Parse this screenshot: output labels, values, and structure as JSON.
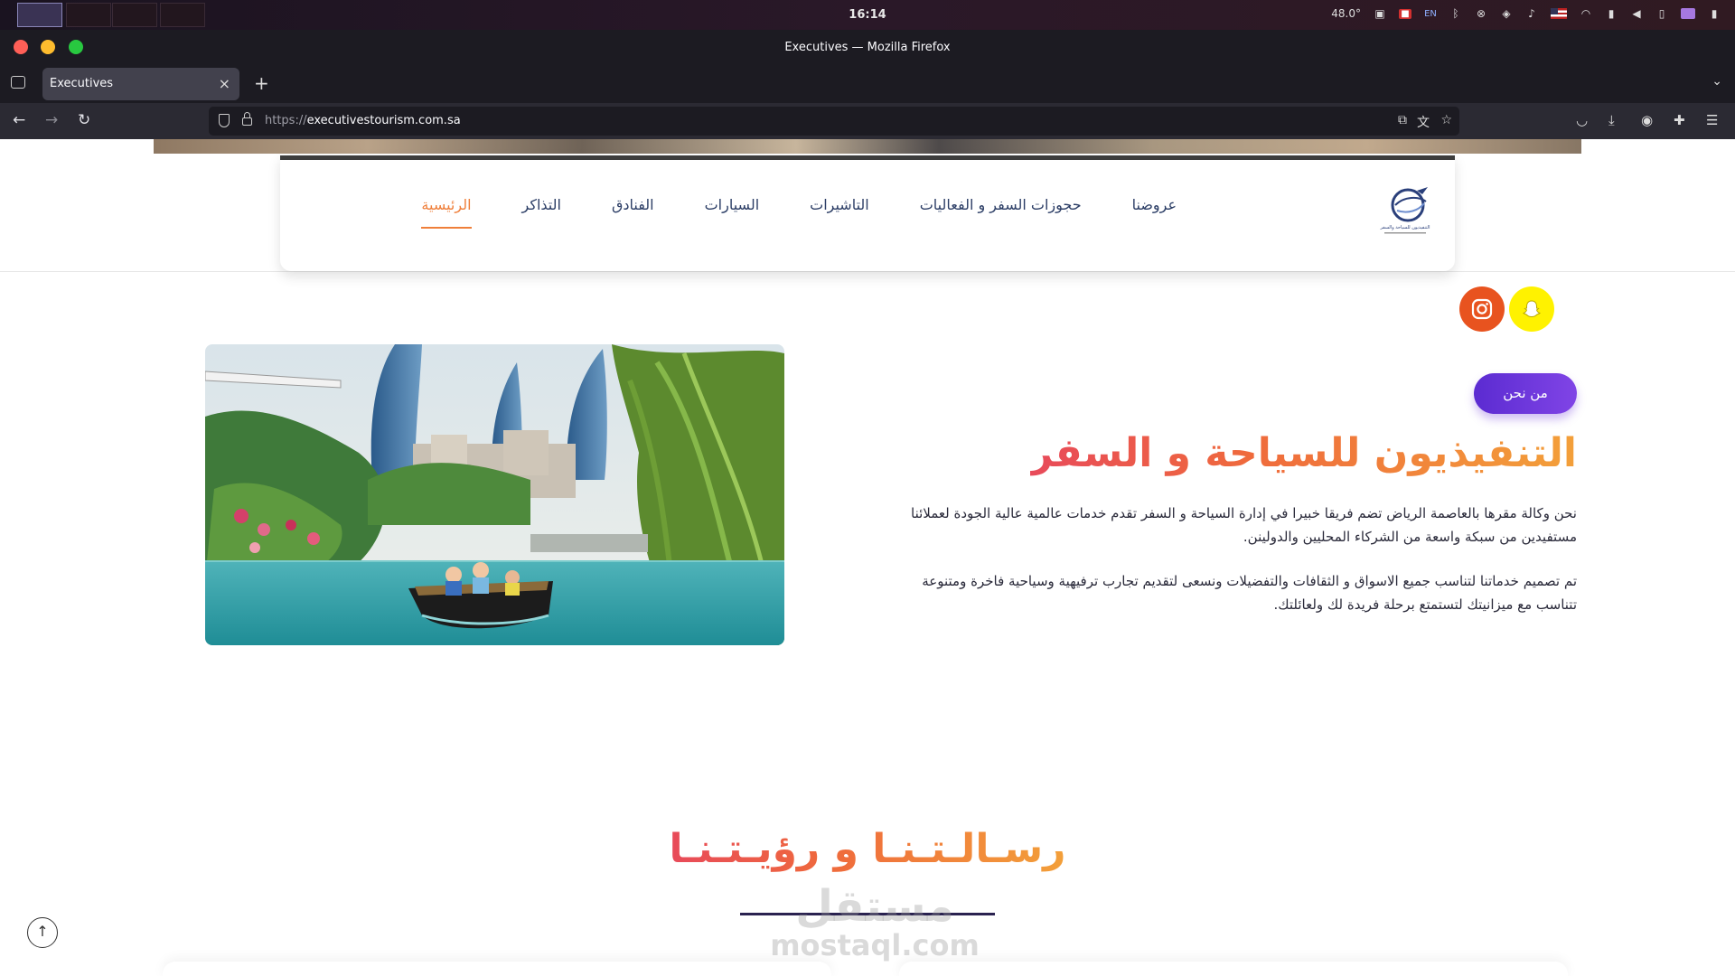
{
  "os": {
    "clock": "16:14",
    "temp": "48.0°",
    "lang": "EN"
  },
  "browser": {
    "window_title": "Executives — Mozilla Firefox",
    "tab_title": "Executives",
    "url_proto": "https://",
    "url_host": "executivestourism.com.sa",
    "icons": [
      "back-icon",
      "forward-icon",
      "reload-icon",
      "shield-icon",
      "lock-icon",
      "bookmark-star-icon",
      "pocket-icon",
      "download-icon",
      "account-icon",
      "extensions-icon",
      "menu-icon"
    ]
  },
  "site": {
    "logo_text": "التنفيذيون للسياحة والسفر",
    "menu": [
      {
        "label": "الرئيسية",
        "active": true
      },
      {
        "label": "التذاكر",
        "active": false
      },
      {
        "label": "الفنادق",
        "active": false
      },
      {
        "label": "السيارات",
        "active": false
      },
      {
        "label": "التاشيرات",
        "active": false
      },
      {
        "label": "حجوزات السفر و الفعاليات",
        "active": false
      },
      {
        "label": "عروضنا",
        "active": false
      }
    ],
    "social": [
      {
        "name": "instagram-icon",
        "color": "#e8531f"
      },
      {
        "name": "snapchat-icon",
        "color": "#fff200"
      }
    ],
    "about": {
      "badge": "من نحن",
      "title": "التنفيذيون للسياحة و السفر",
      "paragraph1": "نحن وكالة مقرها بالعاصمة الرياض تضم فريقا خبيرا في إدارة السياحة و السفر تقدم خدمات عالمية عالية الجودة لعملائنا مستفيدين من سبكة واسعة من الشركاء المحليين والدولينن.",
      "paragraph2": "تم تصميم خدماتنا لتناسب جميع الاسواق و الثقافات والتفضيلات ونسعى لتقديم تجارب ترفيهية وسياحية فاخرة ومتنوعة تتناسب مع ميزانيتك لتستمتع برحلة فريدة لك ولعائلتك."
    },
    "mission_title": "رسـالـتـنـا و رؤيـتـنـا",
    "watermark_ar": "مستقل",
    "watermark_lat": "mostaql.com",
    "colors": {
      "accent_orange": "#ef7f3a",
      "purple": "#5b2bd1",
      "navy": "#2c3e66"
    }
  }
}
